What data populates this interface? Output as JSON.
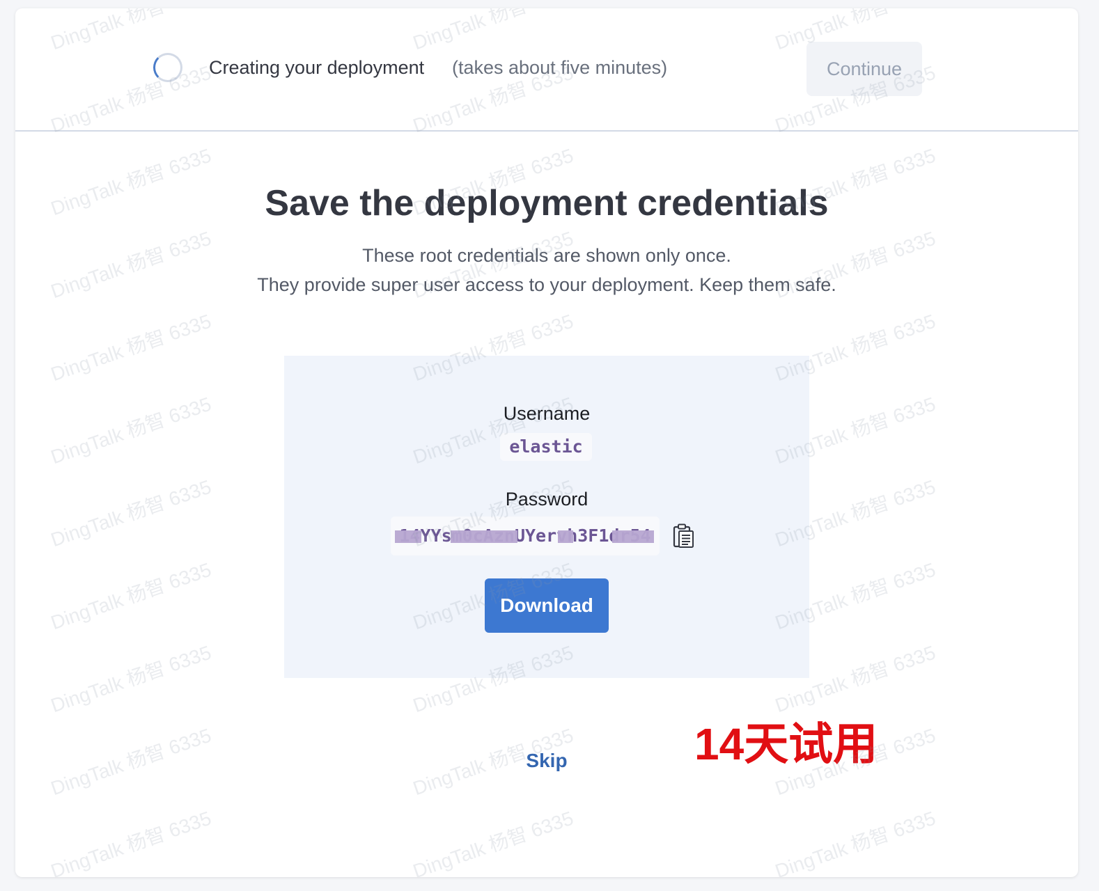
{
  "header": {
    "status_title": "Creating your deployment",
    "status_note": "(takes about five minutes)",
    "continue_label": "Continue"
  },
  "main": {
    "title": "Save the deployment credentials",
    "subtitle_line1": "These root credentials are shown only once.",
    "subtitle_line2": "They provide super user access to your deployment. Keep them safe."
  },
  "credentials": {
    "username_label": "Username",
    "username_value": "elastic",
    "password_label": "Password",
    "password_value": "14YYsm0cAznUYervh3F1dr54",
    "download_label": "Download",
    "copy_icon": "clipboard-icon"
  },
  "skip_label": "Skip",
  "annotation": "14天试用",
  "watermark": "DingTalk 杨智 6335",
  "colors": {
    "primary": "#3d78d1",
    "link": "#3466b0",
    "panel_bg": "#f0f4fb",
    "code_text": "#6b5694",
    "annotation": "#e10f13"
  }
}
